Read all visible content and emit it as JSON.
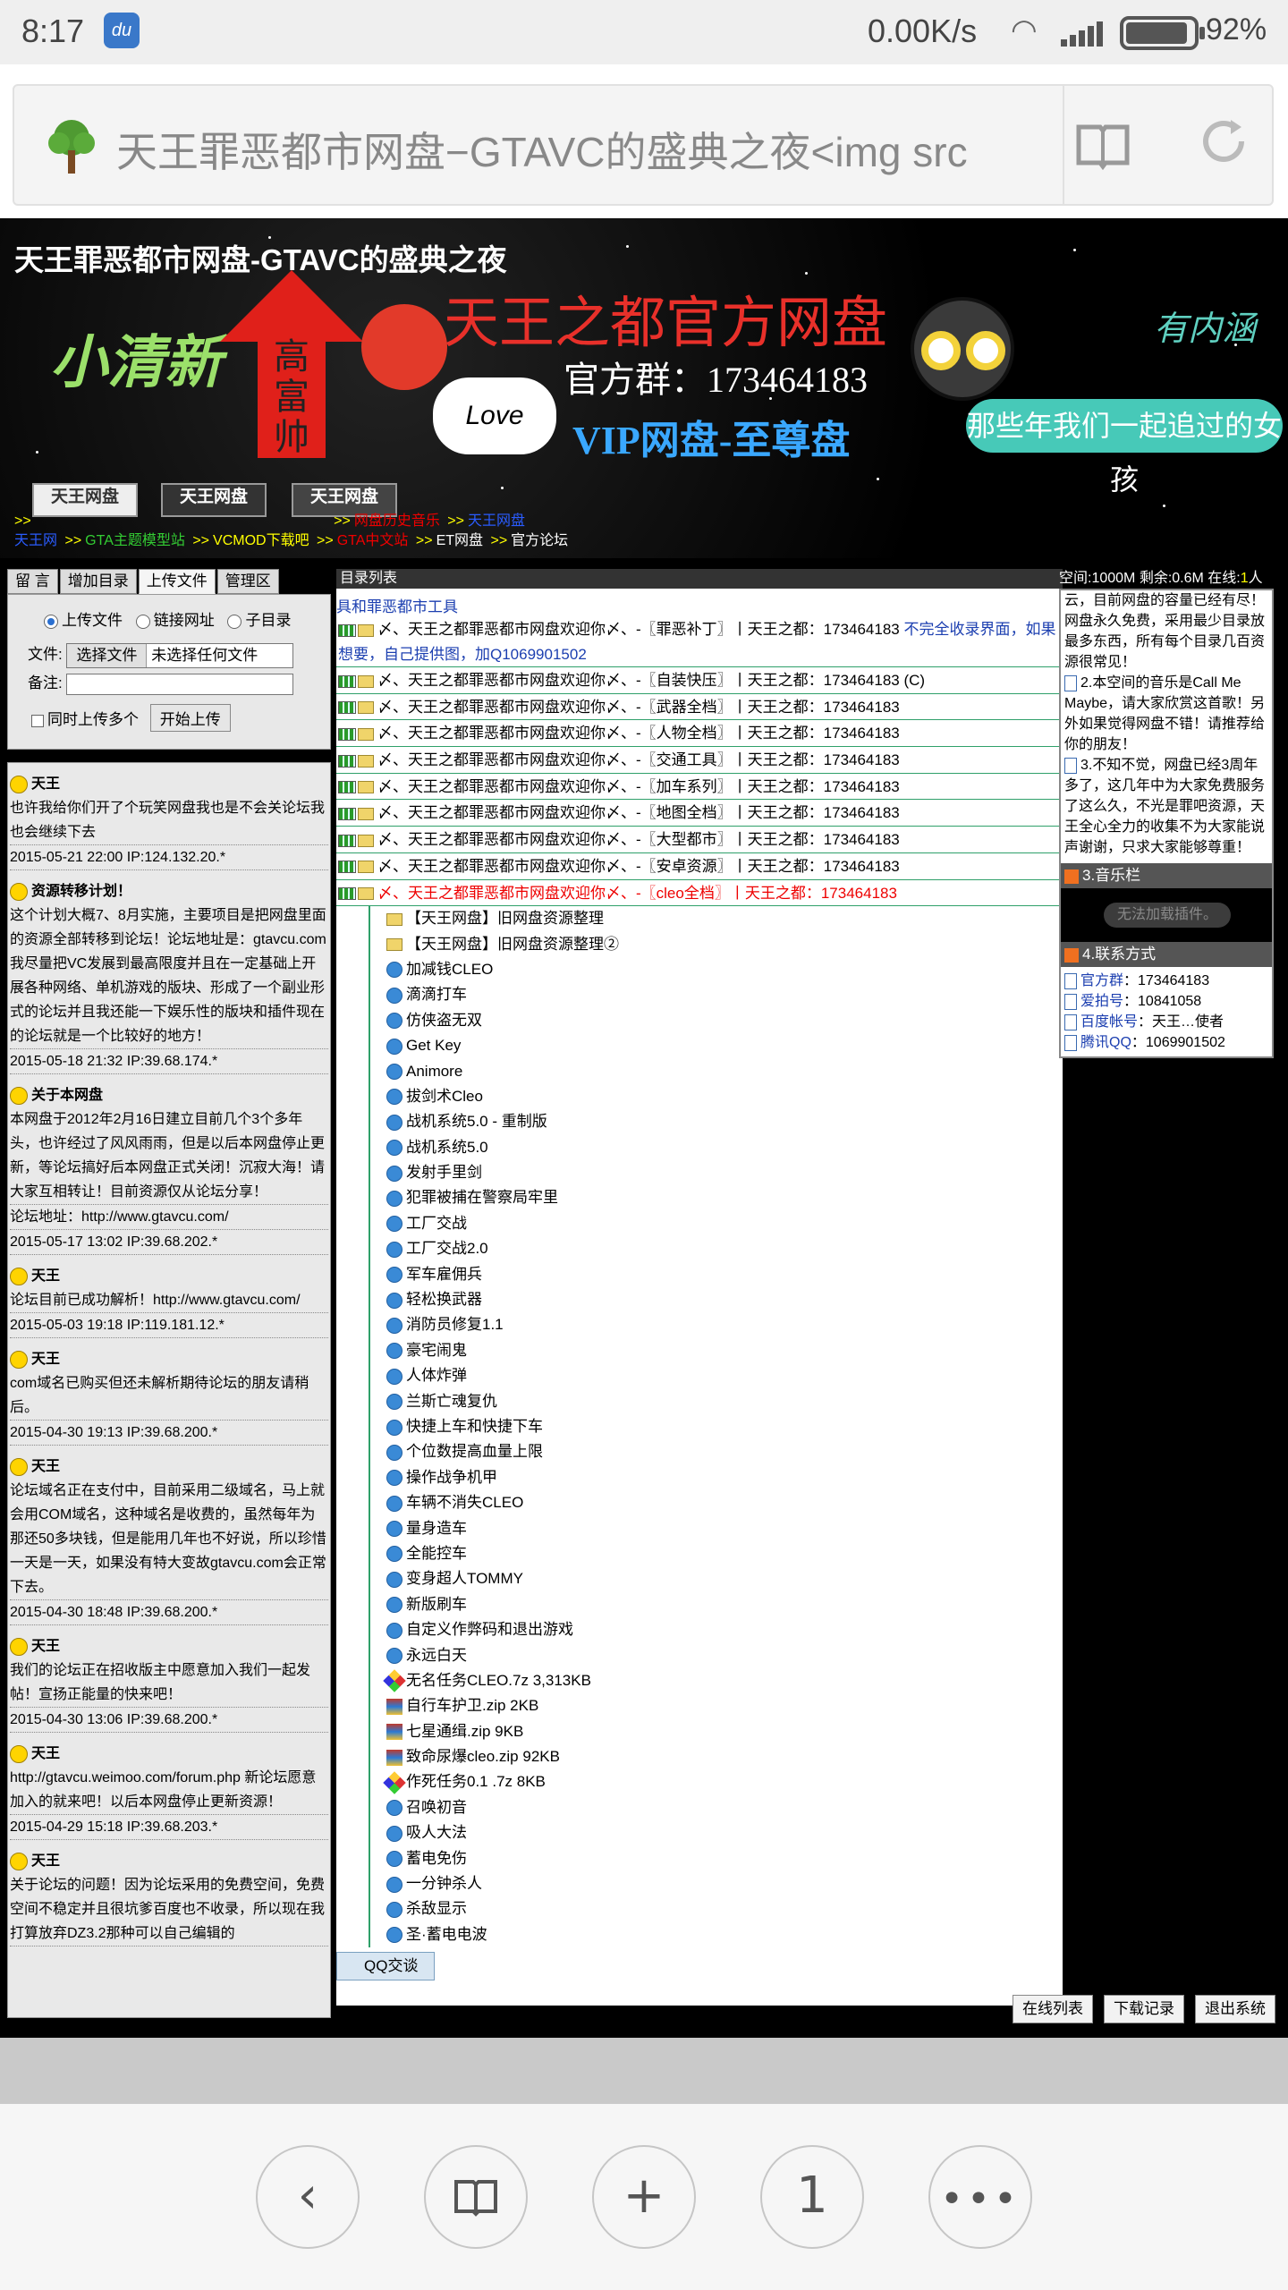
{
  "status": {
    "time": "8:17",
    "app_icon": "du",
    "speed": "0.00K/s",
    "battery": "92%"
  },
  "browser": {
    "url": "天王罪恶都市网盘−GTAVC的盛典之夜<img src"
  },
  "banner": {
    "title": "天王罪恶都市网盘-GTAVC的盛典之夜",
    "fresh": "小清新",
    "arrow_text": "高富帅",
    "official": "天王之都官方网盘",
    "group": "官方群：173464183",
    "love": "Love",
    "vip": "VIP网盘-至尊盘",
    "youth": "那些年我们一起追过的女孩",
    "sign": "有内涵",
    "btn1": "天王网盘",
    "btn2": "天王网盘",
    "btn3": "天王网盘",
    "nav1a": "网盘历史音乐",
    "nav1b": "天王网盘",
    "nav2a": "天王网",
    "nav2b": "GTA主题模型站",
    "nav2c": "VCMOD下载吧",
    "nav2d": "GTA中文站",
    "nav2e": "ET网盘",
    "nav2f": "官方论坛"
  },
  "left": {
    "tabs": [
      "留 言",
      "增加目录",
      "上传文件",
      "管理区"
    ],
    "radio1": "上传文件",
    "radio2": "链接网址",
    "radio3": "子目录",
    "file_label": "文件:",
    "file_button": "选择文件",
    "file_status": "未选择任何文件",
    "note_label": "备注:",
    "multi_label": "同时上传多个",
    "upload_button": "开始上传",
    "messages": [
      {
        "who": "天王",
        "text": "也许我给你们开了个玩笑网盘我也是不会关论坛我也会继续下去",
        "meta": "2015-05-21 22:00  IP:124.132.20.*"
      },
      {
        "who": "资源转移计划！",
        "text": "这个计划大概7、8月实施，主要项目是把网盘里面的资源全部转移到论坛！论坛地址是：gtavcu.com我尽量把VC发展到最高限度并且在一定基础上开展各种网络、单机游戏的版块、形成了一个副业形式的论坛并且我还能一下娱乐性的版块和插件现在的论坛就是一个比较好的地方！",
        "meta": "2015-05-18 21:32  IP:39.68.174.*"
      },
      {
        "who": "关于本网盘",
        "text": "本网盘于2012年2月16日建立目前几个3个多年头，也许经过了风风雨雨，但是以后本网盘停止更新，等论坛搞好后本网盘正式关闭！沉寂大海！请大家互相转让！目前资源仅从论坛分享！",
        "text2": "论坛地址：http://www.gtavcu.com/",
        "meta": "2015-05-17 13:02  IP:39.68.202.*"
      },
      {
        "who": "天王",
        "text": "论坛目前已成功解析！http://www.gtavcu.com/",
        "meta": "2015-05-03 19:18  IP:119.181.12.*"
      },
      {
        "who": "天王",
        "text": "com域名已购买但还未解析期待论坛的朋友请稍后。",
        "meta": "2015-04-30 19:13  IP:39.68.200.*"
      },
      {
        "who": "天王",
        "text": "论坛域名正在支付中，目前采用二级域名，马上就会用COM域名，这种域名是收费的，虽然每年为那还50多块钱，但是能用几年也不好说，所以珍惜一天是一天，如果没有特大变故gtavcu.com会正常下去。",
        "meta": "2015-04-30 18:48  IP:39.68.200.*"
      },
      {
        "who": "天王",
        "text": "我们的论坛正在招收版主中愿意加入我们一起发帖！宣扬正能量的快来吧！",
        "meta": "2015-04-30 13:06  IP:39.68.200.*"
      },
      {
        "who": "天王",
        "text": "http://gtavcu.weimoo.com/forum.php 新论坛愿意加入的就来吧！以后本网盘停止更新资源！",
        "meta": "2015-04-29 15:18  IP:39.68.203.*"
      },
      {
        "who": "天王",
        "text": "关于论坛的问题！因为论坛采用的免费空间，免费空间不稳定并且很坑爹百度也不收录，所以现在我打算放弃DZ3.2那种可以自己编辑的",
        "meta": ""
      }
    ]
  },
  "middle": {
    "header": "目录列表",
    "subheader": "具和罪恶都市工具",
    "rows": [
      {
        "text": "、天王之都罪恶都市网盘欢迎你〆、-〖罪恶补丁〗丨天王之都：173464183",
        "note": "不完全收录界面，如果想要，自己提供图，加Q1069901502"
      },
      {
        "text": "、天王之都罪恶都市网盘欢迎你〆、-〖自装快压〗丨天王之都：173464183 (C)"
      },
      {
        "text": "、天王之都罪恶都市网盘欢迎你〆、-〖武器全档〗丨天王之都：173464183"
      },
      {
        "text": "、天王之都罪恶都市网盘欢迎你〆、-〖人物全档〗丨天王之都：173464183"
      },
      {
        "text": "、天王之都罪恶都市网盘欢迎你〆、-〖交通工具〗丨天王之都：173464183"
      },
      {
        "text": "、天王之都罪恶都市网盘欢迎你〆、-〖加车系列〗丨天王之都：173464183"
      },
      {
        "text": "、天王之都罪恶都市网盘欢迎你〆、-〖地图全档〗丨天王之都：173464183"
      },
      {
        "text": "、天王之都罪恶都市网盘欢迎你〆、-〖大型都市〗丨天王之都：173464183"
      },
      {
        "text": "、天王之都罪恶都市网盘欢迎你〆、-〖安卓资源〗丨天王之都：173464183"
      },
      {
        "text": "、天王之都罪恶都市网盘欢迎你〆、-〖cleo全档〗丨天王之都：173464183"
      }
    ],
    "subitems": [
      {
        "icon": "folder",
        "text": "【天王网盘】旧网盘资源整理"
      },
      {
        "icon": "folder",
        "text": "【天王网盘】旧网盘资源整理②"
      },
      {
        "icon": "ie",
        "text": "加减钱CLEO"
      },
      {
        "icon": "ie",
        "text": "滴滴打车"
      },
      {
        "icon": "ie",
        "text": "仿侠盗无双"
      },
      {
        "icon": "ie",
        "text": "Get Key"
      },
      {
        "icon": "ie",
        "text": "Animore"
      },
      {
        "icon": "ie",
        "text": "拔剑术Cleo"
      },
      {
        "icon": "ie",
        "text": "战机系统5.0 - 重制版"
      },
      {
        "icon": "ie",
        "text": "战机系统5.0"
      },
      {
        "icon": "ie",
        "text": "发射手里剑"
      },
      {
        "icon": "ie",
        "text": "犯罪被捕在警察局牢里"
      },
      {
        "icon": "ie",
        "text": "工厂交战"
      },
      {
        "icon": "ie",
        "text": "工厂交战2.0"
      },
      {
        "icon": "ie",
        "text": "军车雇佣兵"
      },
      {
        "icon": "ie",
        "text": "轻松换武器"
      },
      {
        "icon": "ie",
        "text": "消防员修复1.1"
      },
      {
        "icon": "ie",
        "text": "豪宅闹鬼"
      },
      {
        "icon": "ie",
        "text": "人体炸弹"
      },
      {
        "icon": "ie",
        "text": "兰斯亡魂复仇"
      },
      {
        "icon": "ie",
        "text": "快捷上车和快捷下车"
      },
      {
        "icon": "ie",
        "text": "个位数提高血量上限"
      },
      {
        "icon": "ie",
        "text": "操作战争机甲"
      },
      {
        "icon": "ie",
        "text": "车辆不消失CLEO"
      },
      {
        "icon": "ie",
        "text": "量身造车"
      },
      {
        "icon": "ie",
        "text": "全能控车"
      },
      {
        "icon": "ie",
        "text": "变身超人TOMMY"
      },
      {
        "icon": "ie",
        "text": "新版刷车"
      },
      {
        "icon": "ie",
        "text": "自定义作弊码和退出游戏"
      },
      {
        "icon": "ie",
        "text": "永远白天"
      },
      {
        "icon": "seven",
        "text": "无名任务CLEO.7z 3,313KB"
      },
      {
        "icon": "zip",
        "text": "自行车护卫.zip 2KB"
      },
      {
        "icon": "zip",
        "text": "七星通缉.zip 9KB"
      },
      {
        "icon": "zip",
        "text": "致命尿爆cleo.zip 92KB"
      },
      {
        "icon": "seven",
        "text": "作死任务0.1 .7z 8KB"
      },
      {
        "icon": "ie",
        "text": "召唤初音"
      },
      {
        "icon": "ie",
        "text": "吸人大法"
      },
      {
        "icon": "ie",
        "text": "蓄电免伤"
      },
      {
        "icon": "ie",
        "text": "一分钟杀人"
      },
      {
        "icon": "ie",
        "text": "杀敌显示"
      },
      {
        "icon": "ie",
        "text": "圣·蓄电电波"
      }
    ],
    "qq": "QQ交谈"
  },
  "right": {
    "header_a": "空间:1000M 剩余:0.6M 在线:",
    "online": "1",
    "header_b": "人",
    "notice1": "云，目前网盘的容量已经有尽！网盘永久免费，采用最少目录放最多东西，所有每个目录几百资源很常见！",
    "notice2": "2.本空间的音乐是Call Me Maybe，请大家欣赏这首歌！另外如果觉得网盘不错！请推荐给你的朋友！",
    "notice3": "3.不知不觉，网盘已经3周年多了，这几年中为大家免费服务了这么久，不光是罪吧资源，天王全心全力的收集不为大家能说声谢谢，只求大家能够尊重！",
    "music_title": "3.音乐栏",
    "music_msg": "无法加载插件。",
    "contact_title": "4.联系方式",
    "contacts": [
      {
        "k": "官方群",
        "v": "：173464183"
      },
      {
        "k": "爱拍号",
        "v": "：10841058"
      },
      {
        "k": "百度帐号",
        "v": "：天王…使者"
      },
      {
        "k": "腾讯QQ",
        "v": "：1069901502"
      }
    ]
  },
  "bottom_buttons": {
    "online": "在线列表",
    "downloads": "下载记录",
    "logout": "退出系统"
  },
  "nav": {
    "back": "‹",
    "tabs_count": "1"
  }
}
